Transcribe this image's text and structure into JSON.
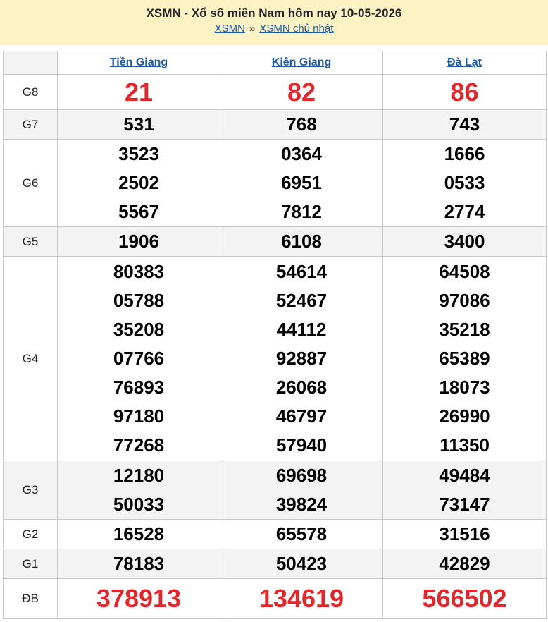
{
  "header": {
    "title": "XSMN - Xổ số miền Nam hôm nay 10-05-2026",
    "breadcrumb": {
      "home": "XSMN",
      "separator": "»",
      "current": "XSMN chủ nhật"
    }
  },
  "provinces": [
    "Tiền Giang",
    "Kiên Giang",
    "Đà Lạt"
  ],
  "prizes": [
    {
      "label": "G8",
      "style": "red",
      "values": [
        [
          "21"
        ],
        [
          "82"
        ],
        [
          "86"
        ]
      ]
    },
    {
      "label": "G7",
      "style": "normal",
      "values": [
        [
          "531"
        ],
        [
          "768"
        ],
        [
          "743"
        ]
      ]
    },
    {
      "label": "G6",
      "style": "normal",
      "values": [
        [
          "3523",
          "2502",
          "5567"
        ],
        [
          "0364",
          "6951",
          "7812"
        ],
        [
          "1666",
          "0533",
          "2774"
        ]
      ]
    },
    {
      "label": "G5",
      "style": "normal",
      "values": [
        [
          "1906"
        ],
        [
          "6108"
        ],
        [
          "3400"
        ]
      ]
    },
    {
      "label": "G4",
      "style": "normal",
      "values": [
        [
          "80383",
          "05788",
          "35208",
          "07766",
          "76893",
          "97180",
          "77268"
        ],
        [
          "54614",
          "52467",
          "44112",
          "92887",
          "26068",
          "46797",
          "57940"
        ],
        [
          "64508",
          "97086",
          "35218",
          "65389",
          "18073",
          "26990",
          "11350"
        ]
      ]
    },
    {
      "label": "G3",
      "style": "normal",
      "values": [
        [
          "12180",
          "50033"
        ],
        [
          "69698",
          "39824"
        ],
        [
          "49484",
          "73147"
        ]
      ]
    },
    {
      "label": "G2",
      "style": "normal",
      "values": [
        [
          "16528"
        ],
        [
          "65578"
        ],
        [
          "31516"
        ]
      ]
    },
    {
      "label": "G1",
      "style": "normal",
      "values": [
        [
          "78183"
        ],
        [
          "50423"
        ],
        [
          "42829"
        ]
      ]
    },
    {
      "label": "ĐB",
      "style": "big-red",
      "values": [
        [
          "378913"
        ],
        [
          "134619"
        ],
        [
          "566502"
        ]
      ]
    }
  ],
  "colors": {
    "header_bg": "#fdf2c4",
    "link": "#1e5ba8",
    "highlight_number": "#e3262b",
    "shaded_row": "#f3f3f3"
  }
}
